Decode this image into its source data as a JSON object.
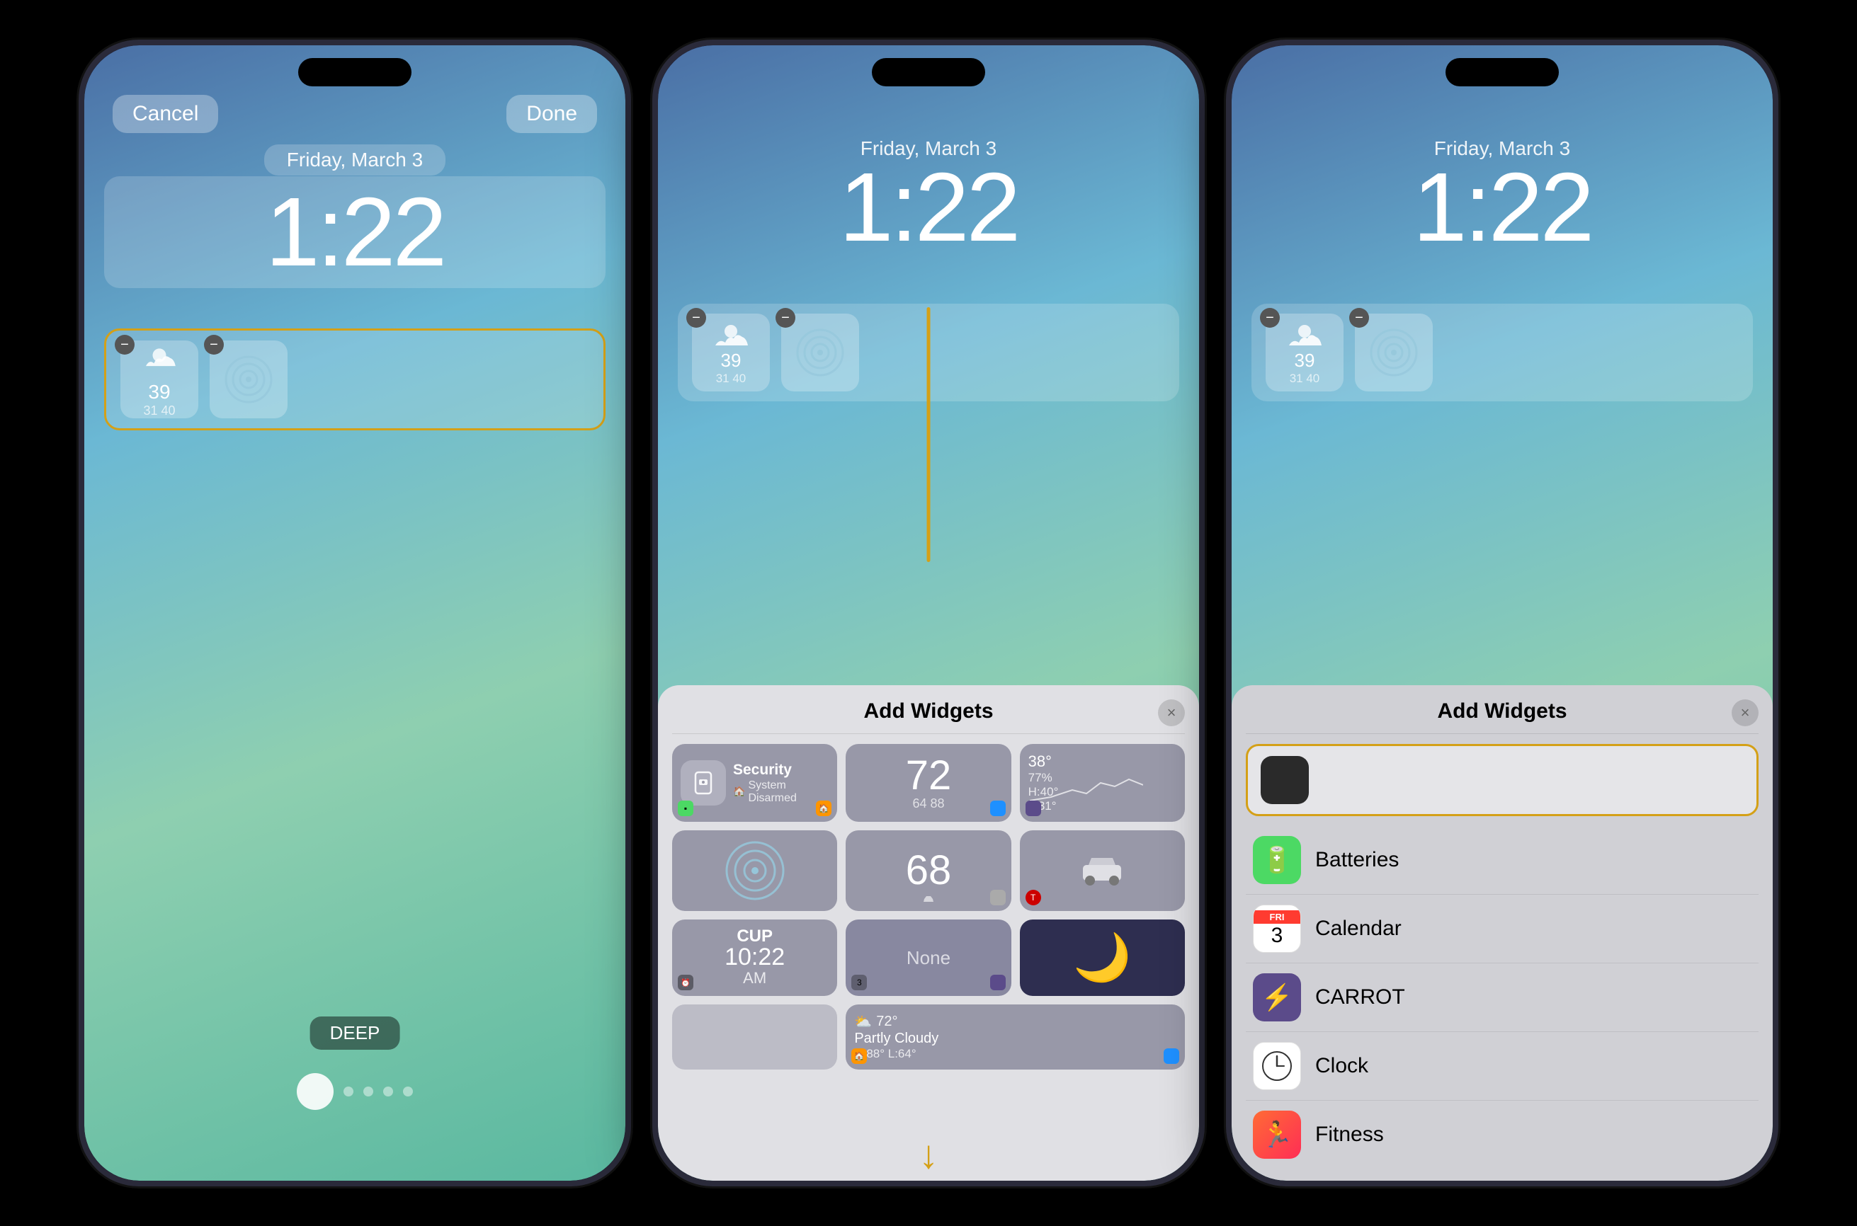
{
  "phone1": {
    "cancel_label": "Cancel",
    "done_label": "Done",
    "date": "Friday, March 3",
    "time": "1:22",
    "widget_temp": "39",
    "widget_temp_low": "31",
    "widget_temp_high": "40",
    "label_deep": "DEEP"
  },
  "phone2": {
    "date": "Friday, March 3",
    "time": "1:22",
    "panel_title": "Add Widgets",
    "close_label": "×",
    "widgets": [
      {
        "id": "security",
        "title": "Security",
        "subtitle": "System Disarmed",
        "type": "security"
      },
      {
        "id": "number72",
        "title": "72",
        "sub1": "64",
        "sub2": "88",
        "type": "number"
      },
      {
        "id": "temp",
        "main": "38°",
        "lines": [
          "77%",
          "H:40°",
          "L:31°"
        ],
        "type": "temp"
      },
      {
        "id": "radar",
        "type": "radar"
      },
      {
        "id": "number68",
        "title": "68",
        "type": "number2"
      },
      {
        "id": "car",
        "type": "car"
      },
      {
        "id": "cup",
        "title": "CUP",
        "sub": "10:22",
        "sub2": "AM",
        "type": "cup"
      },
      {
        "id": "none",
        "title": "None",
        "type": "none"
      },
      {
        "id": "moon",
        "type": "moon"
      },
      {
        "id": "grey1",
        "type": "grey"
      },
      {
        "id": "weather",
        "title": "72°",
        "sub": "Partly Cloudy",
        "sub2": "H:88° L:64°",
        "type": "weather"
      }
    ]
  },
  "phone3": {
    "date": "Friday, March 3",
    "time": "1:22",
    "panel_title": "Add Widgets",
    "close_label": "×",
    "apps": [
      {
        "name": "Batteries",
        "icon_type": "batteries"
      },
      {
        "name": "Calendar",
        "icon_type": "calendar",
        "day": "FRI",
        "num": "3"
      },
      {
        "name": "CARROT",
        "icon_type": "carrot"
      },
      {
        "name": "Clock",
        "icon_type": "clock"
      },
      {
        "name": "Fitness",
        "icon_type": "fitness"
      }
    ]
  }
}
